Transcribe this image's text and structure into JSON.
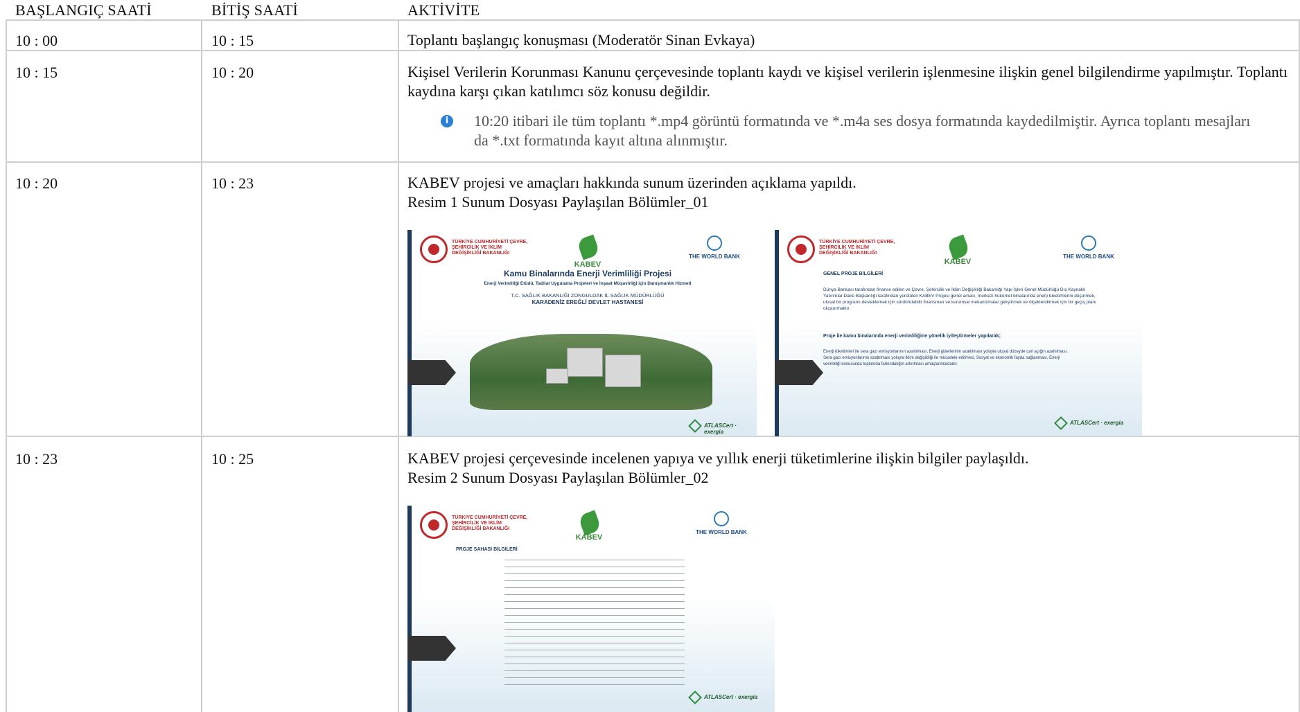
{
  "header": {
    "col_start": "BAŞLANGIÇ SAATİ",
    "col_end": "BİTİŞ SAATİ",
    "col_activity": "AKTİVİTE"
  },
  "rows": [
    {
      "start": "10 : 00",
      "end": "10 : 15",
      "activity": "Toplantı başlangıç konuşması (Moderatör Sinan Evkaya)"
    },
    {
      "start": "10 : 15",
      "end": "10 : 20",
      "activity": "Kişisel Verilerin Korunması Kanunu çerçevesinde toplantı kaydı ve kişisel verilerin işlenmesine ilişkin genel bilgilendirme yapılmıştır. Toplantı kaydına karşı çıkan katılımcı söz konusu değildir.",
      "note": "10:20 itibari ile tüm toplantı *.mp4 görüntü formatında ve *.m4a ses dosya formatında kaydedilmiştir. Ayrıca toplantı mesajları da *.txt formatında kayıt altına alınmıştır."
    },
    {
      "start": "10 : 20",
      "end": "10 : 23",
      "activity": "KABEV projesi ve amaçları hakkında sunum üzerinden açıklama yapıldı.",
      "caption": "Resim 1 Sunum Dosyası Paylaşılan Bölümler_01"
    },
    {
      "start": "10 : 23",
      "end": "10 : 25",
      "activity": "KABEV projesi çerçevesinde incelenen yapıya ve yıllık enerji tüketimlerine ilişkin bilgiler paylaşıldı.",
      "caption": "Resim 2 Sunum Dosyası Paylaşılan Bölümler_02"
    }
  ],
  "slides": {
    "ministry": "TÜRKİYE CUMHURİYETİ ÇEVRE, ŞEHİRCİLİK VE İKLİM DEĞİŞİKLİĞİ BAKANLIĞI",
    "kabev": "KABEV",
    "worldbank": "THE WORLD BANK",
    "footer": "ATLASCert · exergia",
    "s1_title": "Kamu Binalarında Enerji Verimliliği Projesi",
    "s1_sub": "Enerji Verimliliği Etüdü, Tadilat Uygulama Projeleri ve İnşaat Müşavirliği için Danışmanlık Hizmeti",
    "s1_line1": "T.C. SAĞLIK BAKANLIĞI ZONGULDAK İL SAĞLIK MÜDÜRLÜĞÜ",
    "s1_line2": "KARADENİZ EREĞLİ DEVLET HASTANESİ",
    "s2_heading": "GENEL PROJE BİLGİLERİ",
    "s2_para": "Dünya Bankası tarafından finanse edilen ve Çevre, Şehircilik ve İklim Değişikliği Bakanlığı Yapı İşleri Genel Müdürlüğü Dış Kaynaklı Yatırımlar Daire Başkanlığı tarafından yürütülen KABEV Projesi genel amacı, merkezi hükümet binalarında enerji tüketimlerini düşürmek, ulusal bir programı desteklemek için sürdürülebilir finansman ve kurumsal mekanizmalar geliştirmek ve ölçeklendirmek için bir geçiş planı oluşturmaktır.",
    "s2_heading2": "Proje ile kamu binalarında enerji verimliliğine yönelik iyileştirmeler yapılarak;",
    "s2_bullets": "Enerji tüketimleri ile sera gazı emisyonlarının azaltılması, Enerji giderlerinin azaltılması yoluyla ulusal düzeyde cari açığın azaltılması, Sera gazı emisyonlarının azaltılması yoluyla iklim değişikliği ile mücadele edilmesi, Sosyal ve ekonomik fayda sağlanması, Enerji verimliliği konusunda toplumda farkındalığın artırılması amaçlanmaktadır.",
    "s3_heading": "PROJE SAHASI BİLGİLERİ"
  }
}
